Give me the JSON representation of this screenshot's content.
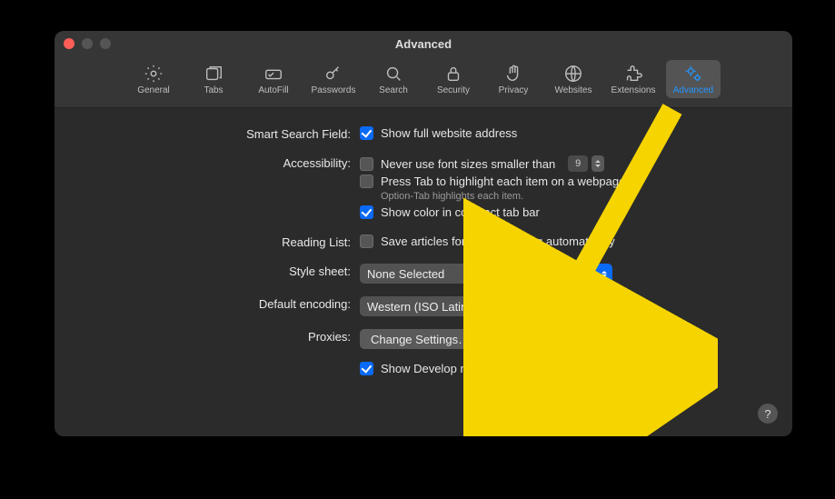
{
  "window": {
    "title": "Advanced"
  },
  "tabs": {
    "general": "General",
    "tabs": "Tabs",
    "autofill": "AutoFill",
    "passwords": "Passwords",
    "search": "Search",
    "security": "Security",
    "privacy": "Privacy",
    "websites": "Websites",
    "extensions": "Extensions",
    "advanced": "Advanced"
  },
  "sections": {
    "smart_search_field": {
      "label": "Smart Search Field:",
      "show_full_address": "Show full website address"
    },
    "accessibility": {
      "label": "Accessibility:",
      "never_use_font": "Never use font sizes smaller than",
      "font_size": "9",
      "press_tab": "Press Tab to highlight each item on a webpage",
      "option_tab_hint": "Option-Tab highlights each item.",
      "show_color": "Show color in compact tab bar"
    },
    "reading_list": {
      "label": "Reading List:",
      "save_offline": "Save articles for offline reading automatically"
    },
    "style_sheet": {
      "label": "Style sheet:",
      "value": "None Selected"
    },
    "default_encoding": {
      "label": "Default encoding:",
      "value": "Western (ISO Latin 1)"
    },
    "proxies": {
      "label": "Proxies:",
      "button": "Change Settings…"
    },
    "develop_menu": {
      "label": "Show Develop menu in menu bar"
    }
  },
  "help": "?"
}
